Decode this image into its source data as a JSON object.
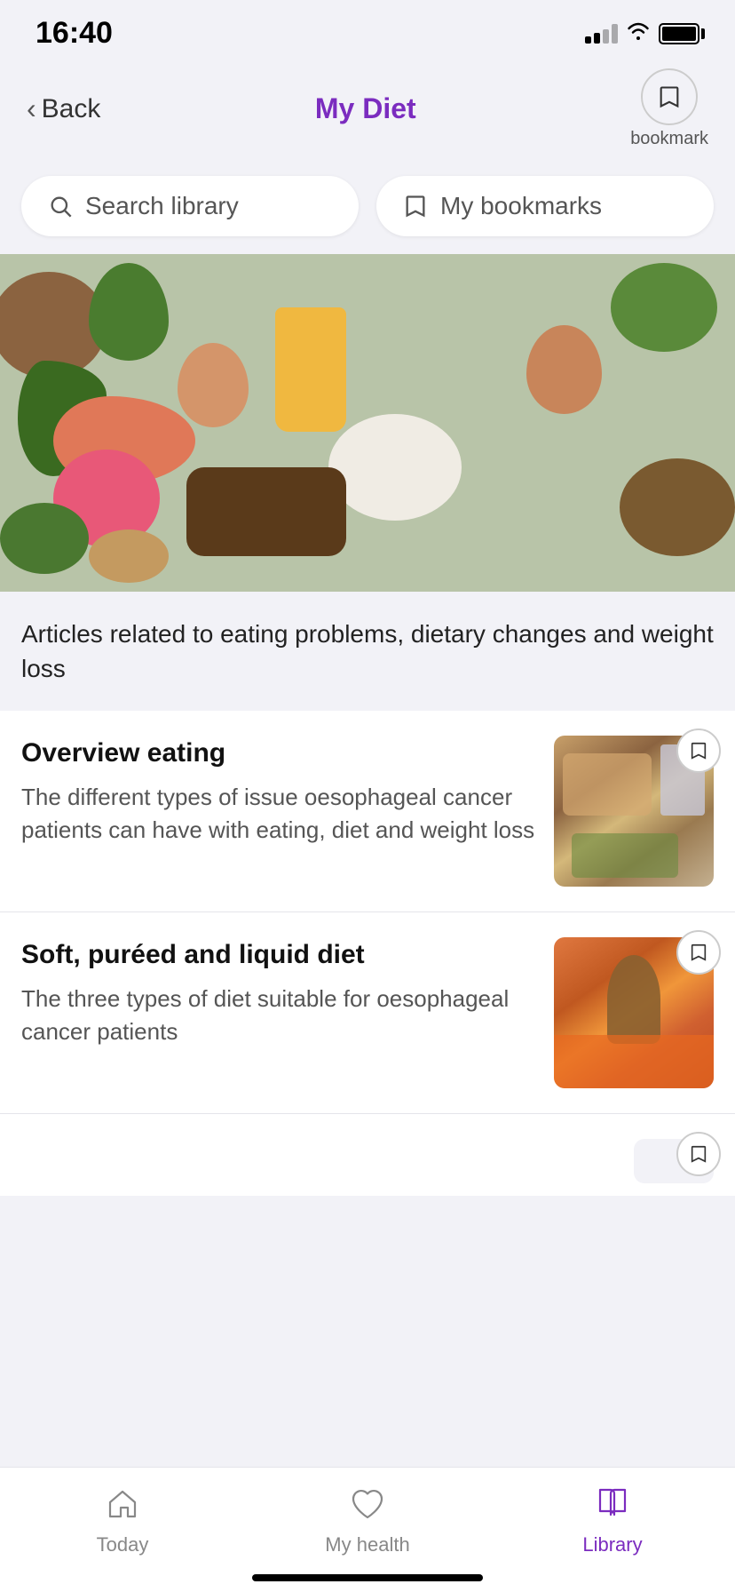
{
  "statusBar": {
    "time": "16:40"
  },
  "header": {
    "back_label": "Back",
    "title": "My Diet",
    "bookmark_label": "bookmark"
  },
  "searchRow": {
    "search_btn_label": "Search library",
    "bookmarks_btn_label": "My bookmarks"
  },
  "hero": {
    "description": "Articles related to eating problems, dietary changes and weight loss"
  },
  "articles": [
    {
      "title": "Overview eating",
      "description": "The different types of issue oesophageal cancer patients can have with eating, diet and weight loss"
    },
    {
      "title": "Soft, puréed and liquid diet",
      "description": "The three types of diet suitable for oesophageal cancer patients"
    }
  ],
  "bottomNav": {
    "items": [
      {
        "label": "Today",
        "icon": "home-icon",
        "active": false
      },
      {
        "label": "My health",
        "icon": "heart-icon",
        "active": false
      },
      {
        "label": "Library",
        "icon": "book-icon",
        "active": true
      }
    ]
  }
}
